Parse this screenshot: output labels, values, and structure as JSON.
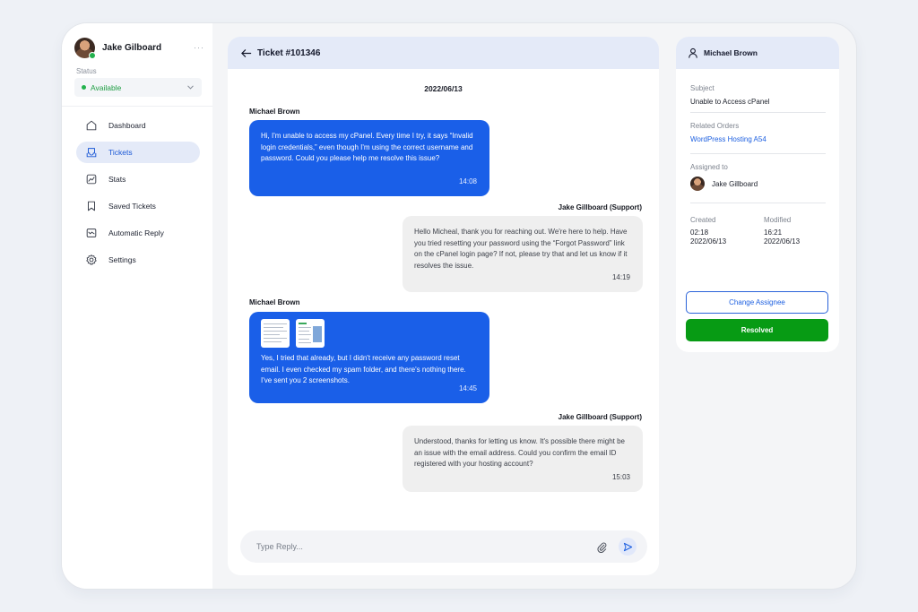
{
  "sidebar": {
    "user_name": "Jake Gilboard",
    "more": "···",
    "status_label": "Status",
    "status_value": "Available",
    "items": [
      {
        "label": "Dashboard",
        "icon": "home-icon"
      },
      {
        "label": "Tickets",
        "icon": "ticket-icon",
        "active": true
      },
      {
        "label": "Stats",
        "icon": "stats-icon"
      },
      {
        "label": "Saved Tickets",
        "icon": "bookmark-icon"
      },
      {
        "label": "Automatic Reply",
        "icon": "auto-reply-icon"
      },
      {
        "label": "Settings",
        "icon": "gear-icon"
      }
    ]
  },
  "chat": {
    "title": "Ticket #101346",
    "date": "2022/06/13",
    "messages": [
      {
        "sender": "Michael Brown",
        "role": "user",
        "text": "Hi, I'm unable to access my cPanel. Every time I try, it says “Invalid login credentials,” even though I'm using the correct username and password. Could you please help me resolve this issue?",
        "time": "14:08"
      },
      {
        "sender": "Jake Gillboard (Support)",
        "role": "support",
        "text": "Hello Micheal, thank you for reaching out. We're here to help. Have you tried resetting your password using the “Forgot Password” link on the cPanel login page? If not, please try that and let us know if it resolves the issue.",
        "time": "14:19"
      },
      {
        "sender": "Michael Brown",
        "role": "user",
        "text": "Yes, I tried that already, but I didn't receive any password reset email. I even checked my spam folder, and there's nothing there. I've sent you 2 screenshots.",
        "time": "14:45",
        "attachments": 2
      },
      {
        "sender": "Jake Gillboard (Support)",
        "role": "support",
        "text": "Understood, thanks for letting us know. It's possible there might be an issue with the email address. Could you confirm the email ID registered with your hosting account?",
        "time": "15:03"
      }
    ],
    "reply_placeholder": "Type Reply..."
  },
  "details": {
    "name": "Michael Brown",
    "subject_label": "Subject",
    "subject_value": "Unable to Access cPanel",
    "orders_label": "Related Orders",
    "orders_value": "WordPress Hosting A54",
    "assigned_label": "Assigned to",
    "assigned_value": "Jake Gillboard",
    "created_label": "Created",
    "created_time": "02:18",
    "created_date": "2022/06/13",
    "modified_label": "Modified",
    "modified_time": "16:21",
    "modified_date": "2022/06/13",
    "change_button": "Change Assignee",
    "resolve_button": "Resolved"
  },
  "colors": {
    "accent": "#1a5fe8",
    "header_bg": "#e4eaf8",
    "success": "#079b14",
    "online": "#22b24c"
  }
}
